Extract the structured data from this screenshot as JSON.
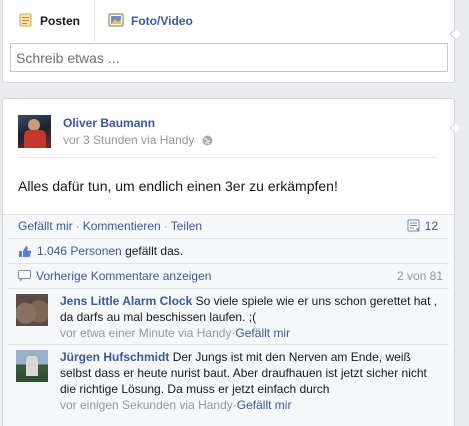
{
  "composer": {
    "tabs": [
      {
        "label": "Posten"
      },
      {
        "label": "Foto/Video"
      }
    ],
    "placeholder": "Schreib etwas ..."
  },
  "story": {
    "author": "Oliver Baumann",
    "meta": "vor 3 Stunden via Handy",
    "text": "Alles dafür tun, um endlich einen 3er zu erkämpfen!",
    "actions": {
      "like": "Gefällt mir",
      "comment": "Kommentieren",
      "share": "Teilen",
      "separator": "·",
      "comment_count": "12"
    },
    "likes": {
      "count_link": "1.046 Personen",
      "suffix": "gefällt das."
    },
    "previous": {
      "label": "Vorherige Kommentare anzeigen",
      "pager": "2 von 81"
    },
    "comments": [
      {
        "name": "Jens Little Alarm Clock",
        "text": "So viele spiele wie er uns schon gerettet hat , da darfs au mal beschissen laufen. ;(",
        "time": "vor etwa einer Minute via Handy",
        "like": "Gefällt mir"
      },
      {
        "name": "Jürgen Hufschmidt",
        "text": "Der Jungs ist mit den Nerven am Ende, weiß selbst dass er heute nurist baut. Aber draufhauen ist jetzt sicher nicht die richtige Lösung. Da muss er jetzt einfach durch",
        "time": "vor einigen Sekunden via Handy",
        "like": "Gefällt mir"
      }
    ]
  },
  "colors": {
    "link": "#3b5998",
    "muted": "#9197a3",
    "background": "#e9ebee",
    "ufi": "#f6f7f8"
  },
  "icons": [
    "posten-icon",
    "photo-icon",
    "globe-icon",
    "comment-count-icon",
    "thumbs-up-icon",
    "comment-bubble-icon"
  ]
}
